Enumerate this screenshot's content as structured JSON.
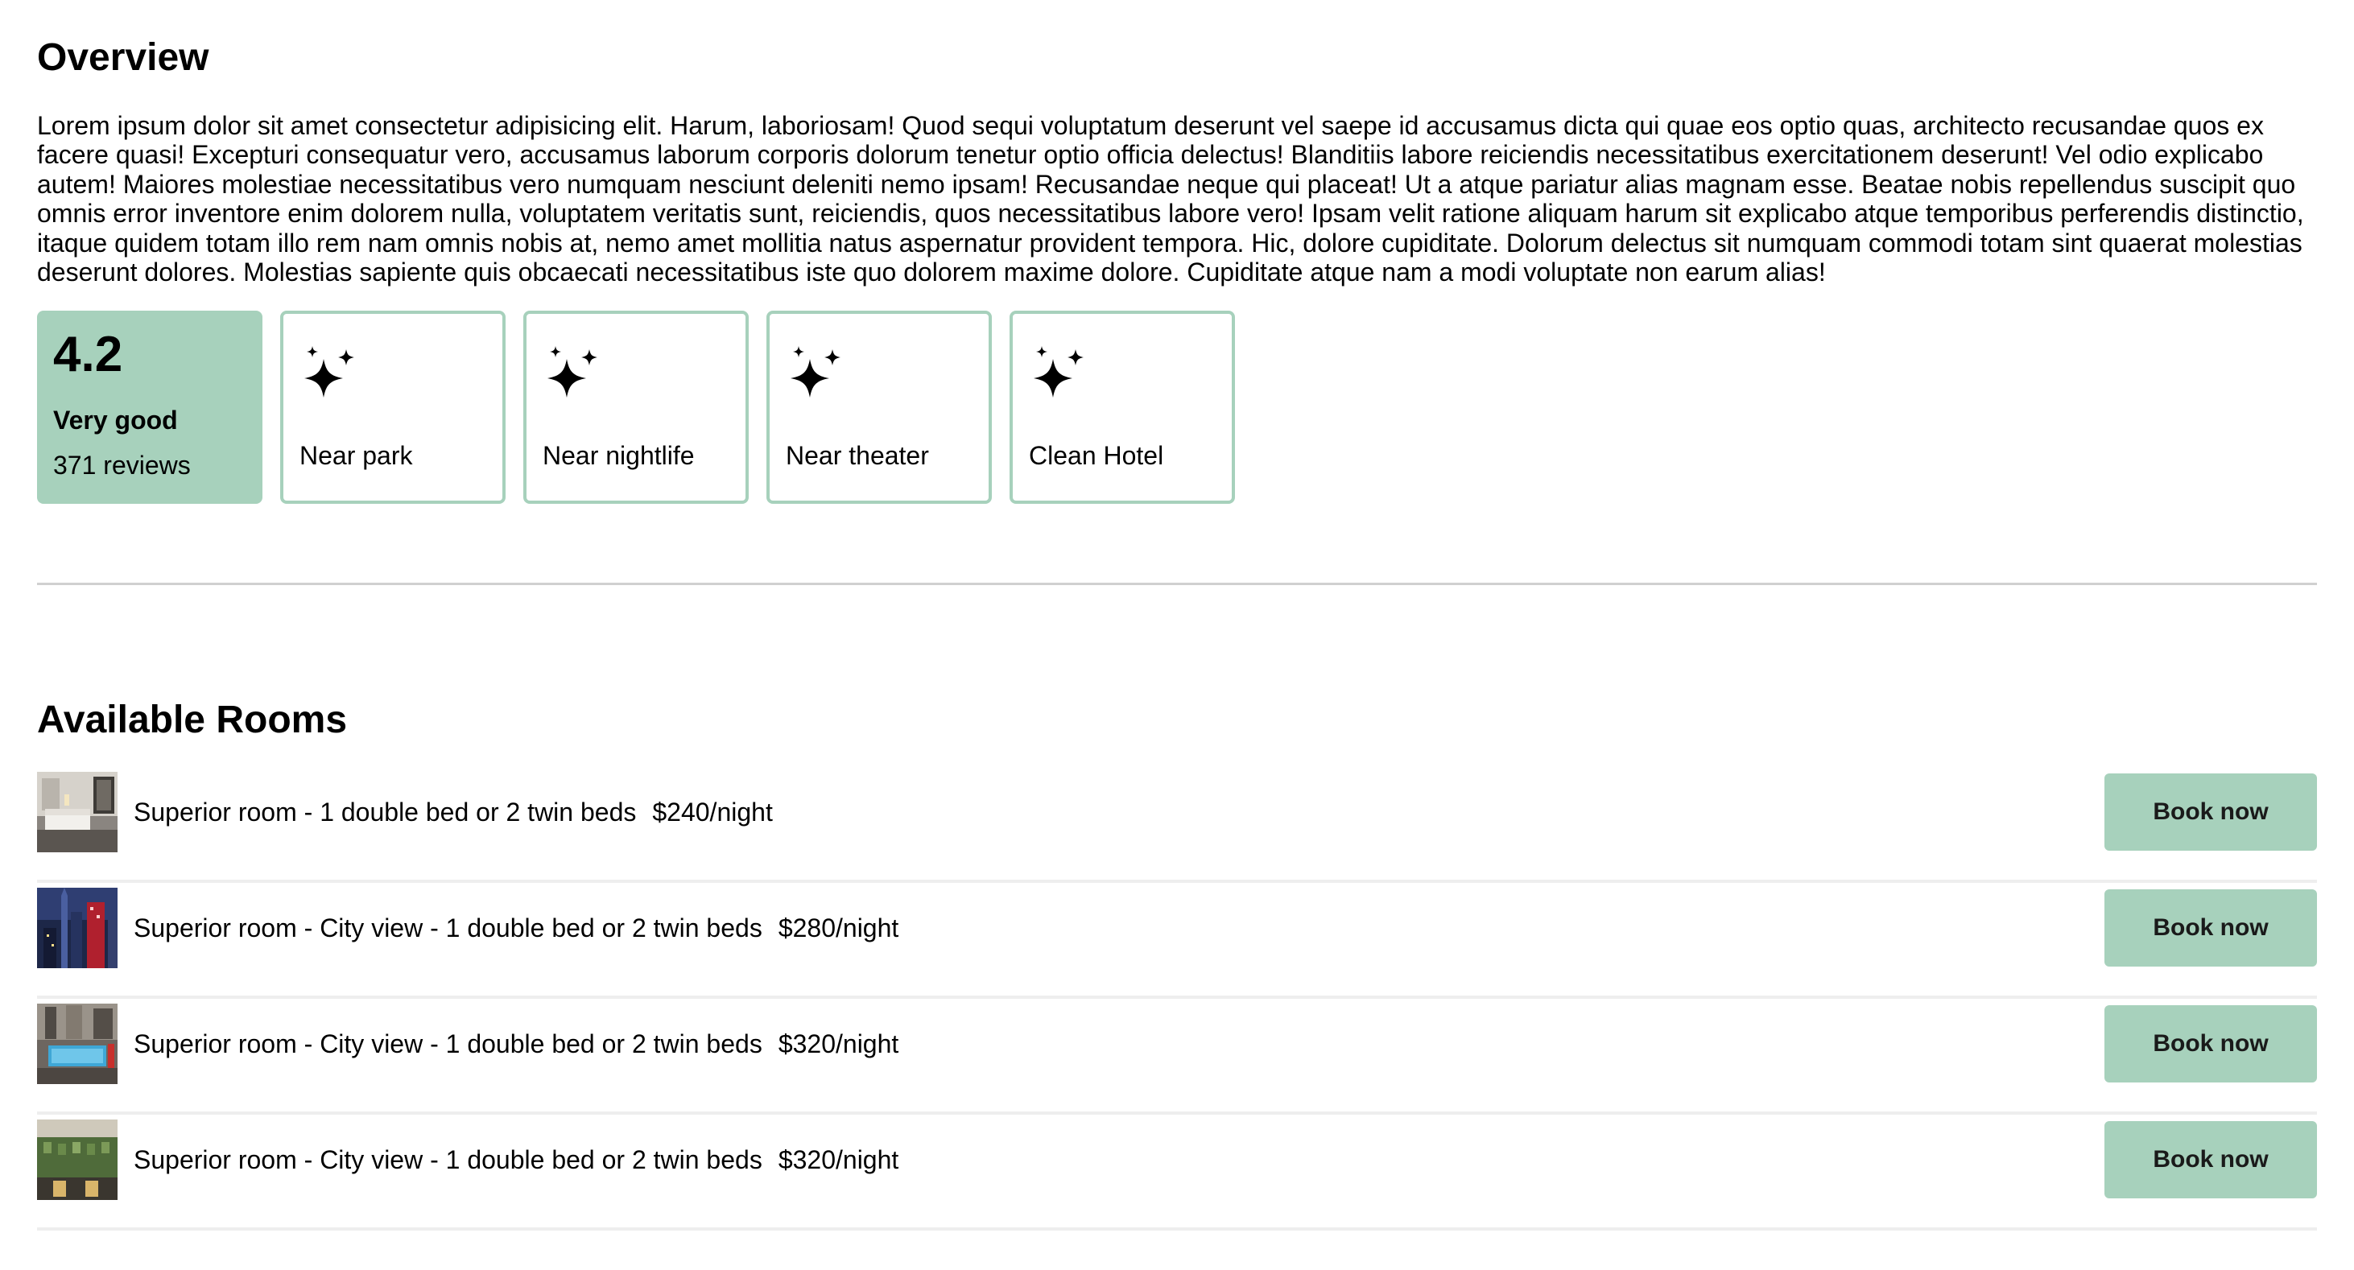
{
  "overview": {
    "title": "Overview",
    "description": "Lorem ipsum dolor sit amet consectetur adipisicing elit. Harum, laboriosam! Quod sequi voluptatum deserunt vel saepe id accusamus dicta qui quae eos optio quas, architecto recusandae quos ex facere quasi! Excepturi consequatur vero, accusamus laborum corporis dolorum tenetur optio officia delectus! Blanditiis labore reiciendis necessitatibus exercitationem deserunt! Vel odio explicabo autem! Maiores molestiae necessitatibus vero numquam nesciunt deleniti nemo ipsam! Recusandae neque qui placeat! Ut a atque pariatur alias magnam esse. Beatae nobis repellendus suscipit quo omnis error inventore enim dolorem nulla, voluptatem veritatis sunt, reiciendis, quos necessitatibus labore vero! Ipsam velit ratione aliquam harum sit explicabo atque temporibus perferendis distinctio, itaque quidem totam illo rem nam omnis nobis at, nemo amet mollitia natus aspernatur provident tempora. Hic, dolore cupiditate. Dolorum delectus sit numquam commodi totam sint quaerat molestias deserunt dolores. Molestias sapiente quis obcaecati necessitatibus iste quo dolorem maxime dolore. Cupiditate atque nam a modi voluptate non earum alias!"
  },
  "rating": {
    "score": "4.2",
    "label": "Very good",
    "reviews": "371 reviews",
    "color": "#a7d1bc"
  },
  "features": [
    {
      "icon": "sparkles-icon",
      "label": "Near park"
    },
    {
      "icon": "sparkles-icon",
      "label": "Near nightlife"
    },
    {
      "icon": "sparkles-icon",
      "label": "Near theater"
    },
    {
      "icon": "sparkles-icon",
      "label": "Clean Hotel"
    }
  ],
  "rooms": {
    "title": "Available Rooms",
    "items": [
      {
        "name": "Superior room - 1 double bed or 2 twin beds",
        "price": "$240/night",
        "button": "Book now",
        "thumb": "hotel-room-photo"
      },
      {
        "name": "Superior room - City view - 1 double bed or 2 twin beds",
        "price": "$280/night",
        "button": "Book now",
        "thumb": "city-night-photo"
      },
      {
        "name": "Superior room - City view - 1 double bed or 2 twin beds",
        "price": "$320/night",
        "button": "Book now",
        "thumb": "pool-photo"
      },
      {
        "name": "Superior room - City view - 1 double bed or 2 twin beds",
        "price": "$320/night",
        "button": "Book now",
        "thumb": "hotel-facade-photo"
      }
    ]
  }
}
